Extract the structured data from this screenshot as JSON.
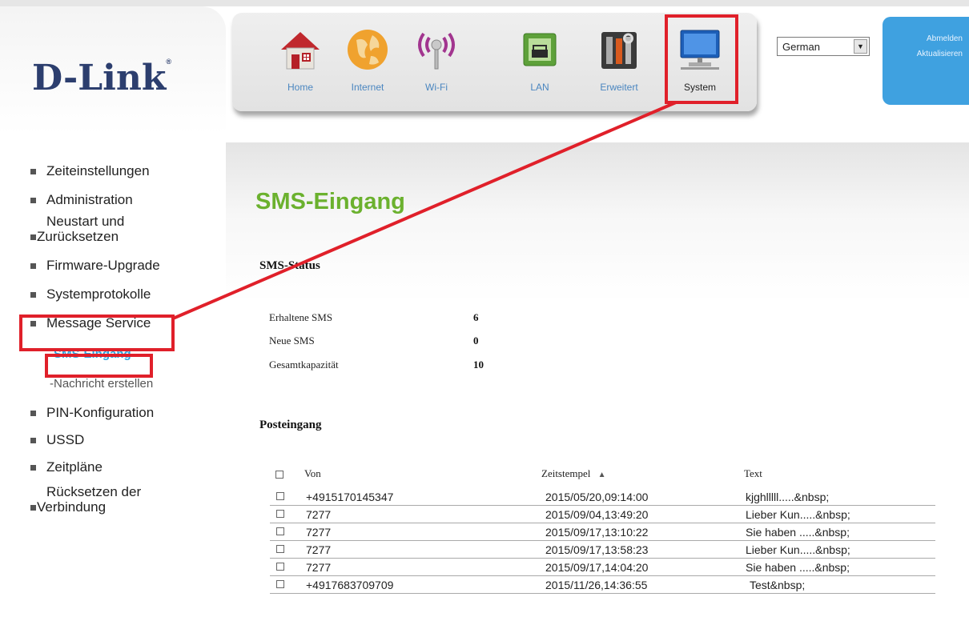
{
  "brand": {
    "logo": "D-Link",
    "mark": "®"
  },
  "nav": [
    {
      "label": "Home",
      "icon": "home-icon"
    },
    {
      "label": "Internet",
      "icon": "globe-icon"
    },
    {
      "label": "Wi-Fi",
      "icon": "wifi-icon"
    },
    {
      "label": "LAN",
      "icon": "lan-icon"
    },
    {
      "label": "Erweitert",
      "icon": "tools-icon"
    },
    {
      "label": "System",
      "icon": "monitor-icon",
      "selected": true
    }
  ],
  "language": {
    "selected": "German"
  },
  "actions": {
    "logout": "Abmelden",
    "refresh": "Aktualisieren"
  },
  "sidebar": {
    "items": [
      {
        "label": "Zeiteinstellungen"
      },
      {
        "label": "Administration"
      },
      {
        "label": "Neustart und Zurücksetzen",
        "line1": "Neustart und",
        "line2": "Zurücksetzen"
      },
      {
        "label": "Firmware-Upgrade"
      },
      {
        "label": "Systemprotokolle"
      },
      {
        "label": "Message Service"
      },
      {
        "label": "PIN-Konfiguration"
      },
      {
        "label": "USSD"
      },
      {
        "label": "Zeitpläne"
      },
      {
        "label": "Rücksetzen der Verbindung",
        "line1": "Rücksetzen der",
        "line2": "Verbindung"
      }
    ],
    "sub": [
      {
        "label": "-SMS-Eingang",
        "active": true
      },
      {
        "label": "-Nachricht erstellen"
      }
    ]
  },
  "page": {
    "title": "SMS-Eingang"
  },
  "status": {
    "heading": "SMS-Status",
    "rows": [
      {
        "label": "Erhaltene SMS",
        "value": "6"
      },
      {
        "label": "Neue SMS",
        "value": "0"
      },
      {
        "label": "Gesamtkapazität",
        "value": "10"
      }
    ]
  },
  "inbox": {
    "heading": "Posteingang",
    "columns": {
      "from": "Von",
      "timestamp": "Zeitstempel",
      "sort": "▲",
      "text": "Text"
    },
    "messages": [
      {
        "from": "+4915170145347",
        "timestamp": "2015/05/20,09:14:00",
        "text": "kjghlllll.....&nbsp;"
      },
      {
        "from": "7277",
        "timestamp": "2015/09/04,13:49:20",
        "text": "Lieber Kun.....&nbsp;"
      },
      {
        "from": "7277",
        "timestamp": "2015/09/17,13:10:22",
        "text": "Sie haben .....&nbsp;"
      },
      {
        "from": "7277",
        "timestamp": "2015/09/17,13:58:23",
        "text": "Lieber Kun.....&nbsp;"
      },
      {
        "from": "7277",
        "timestamp": "2015/09/17,14:04:20",
        "text": "Sie haben .....&nbsp;"
      },
      {
        "from": "+4917683709709",
        "timestamp": "2015/11/26,14:36:55",
        "text": "Test&nbsp;"
      }
    ]
  },
  "colors": {
    "accent_green": "#6bb12e",
    "link_blue": "#4a86c0",
    "annotation_red": "#e0202a",
    "side_blue": "#3fa1e0"
  }
}
